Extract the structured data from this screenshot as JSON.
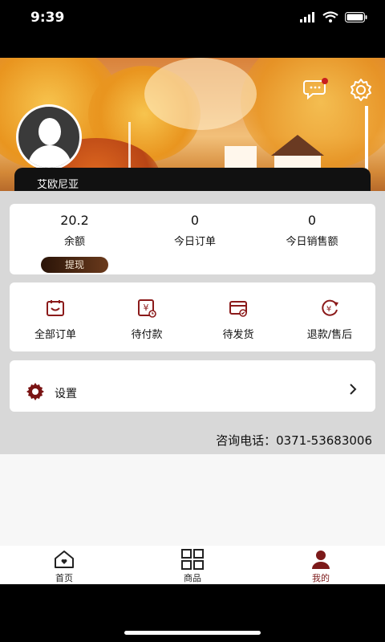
{
  "status_bar": {
    "time": "9:39"
  },
  "profile": {
    "name": "艾欧尼亚"
  },
  "stats": [
    {
      "value": "20.2",
      "label": "余额"
    },
    {
      "value": "0",
      "label": "今日订单"
    },
    {
      "value": "0",
      "label": "今日销售额"
    }
  ],
  "withdraw_label": "提现",
  "orders": [
    {
      "label": "全部订单",
      "icon": "all-orders-icon"
    },
    {
      "label": "待付款",
      "icon": "pending-payment-icon"
    },
    {
      "label": "待发货",
      "icon": "pending-shipment-icon"
    },
    {
      "label": "退款/售后",
      "icon": "refund-icon"
    }
  ],
  "settings_label": "设置",
  "contact": "咨询电话：0371-53683006",
  "tabs": [
    {
      "label": "首页",
      "icon": "home-icon"
    },
    {
      "label": "商品",
      "icon": "grid-icon"
    },
    {
      "label": "我的",
      "icon": "user-icon",
      "active": true
    }
  ],
  "colors": {
    "accent": "#8b1a1a",
    "withdraw_bg": "#4a2410"
  }
}
